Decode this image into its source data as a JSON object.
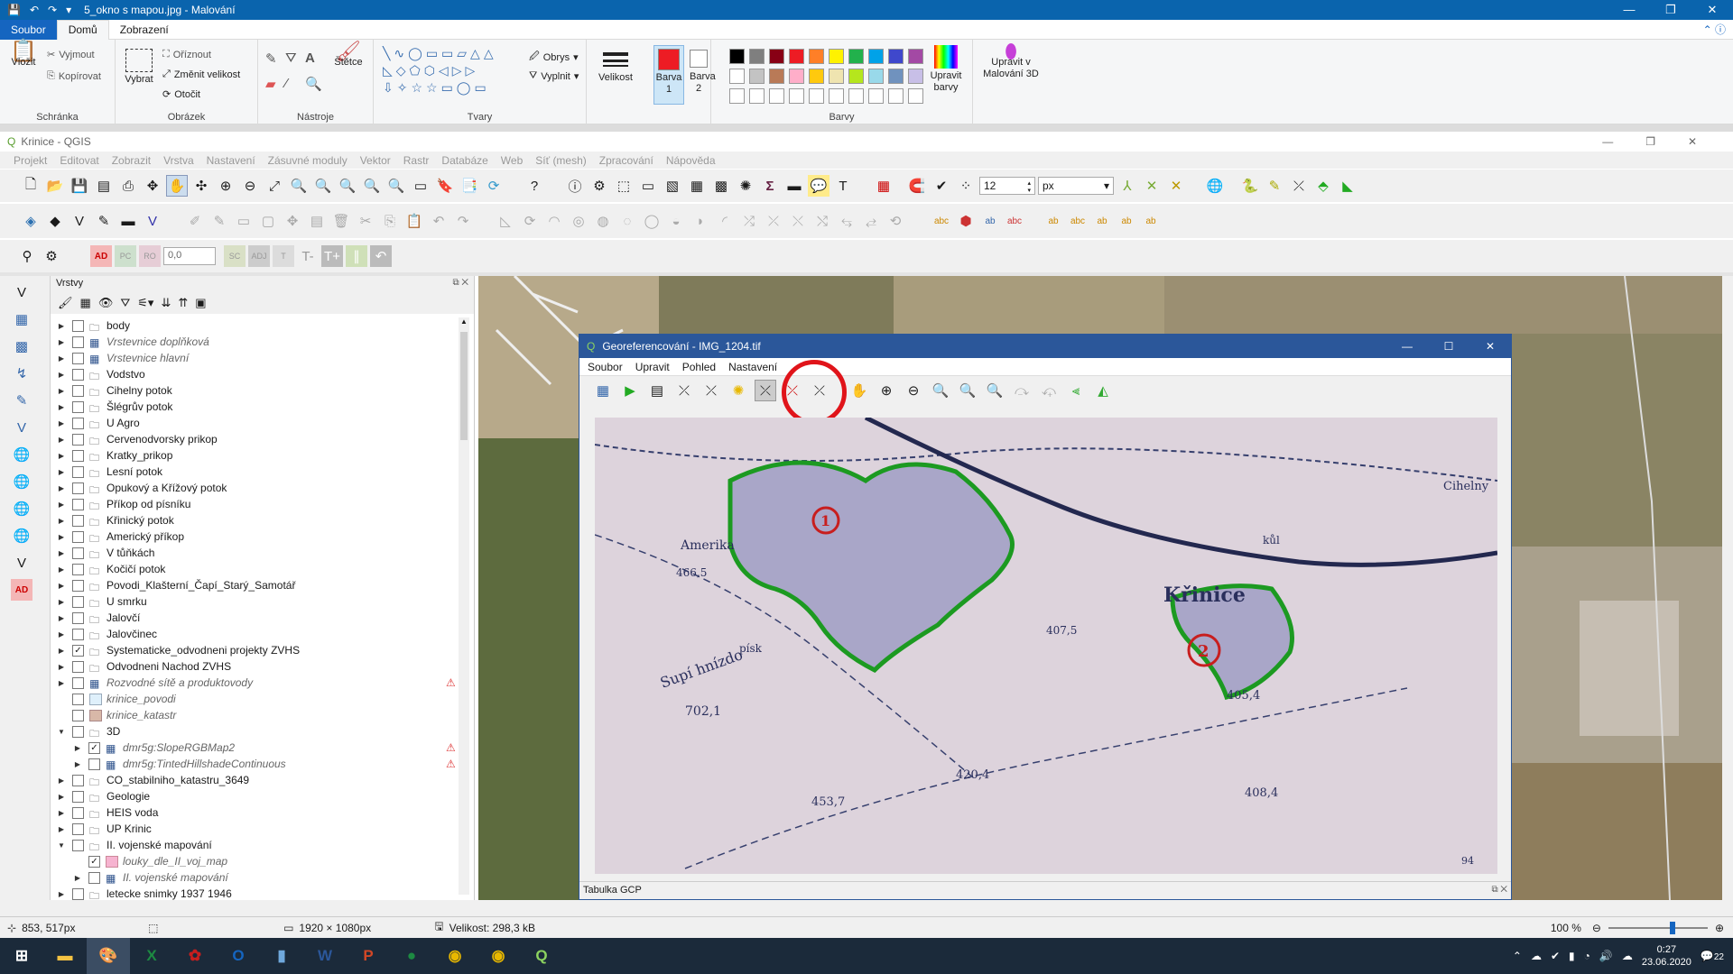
{
  "paint": {
    "title": "5_okno s mapou.jpg - Malování",
    "tabs": [
      "Soubor",
      "Domů",
      "Zobrazení"
    ],
    "clipboard": {
      "paste": "Vložit",
      "cut": "Vyjmout",
      "copy": "Kopírovat",
      "group": "Schránka"
    },
    "image": {
      "select": "Vybrat",
      "crop": "Oříznout",
      "resize": "Změnit velikost",
      "rotate": "Otočit",
      "group": "Obrázek"
    },
    "tools": {
      "group": "Nástroje",
      "brushes": "Štětce"
    },
    "shapes": {
      "outline": "Obrys",
      "fill": "Vyplnit",
      "group": "Tvary"
    },
    "size": "Velikost",
    "color1": "Barva\n1",
    "color2": "Barva\n2",
    "colors_group": "Barvy",
    "edit_colors": "Upravit\nbarvy",
    "paint3d": "Upravit v\nMalování 3D",
    "palette": [
      "#000000",
      "#7f7f7f",
      "#880015",
      "#ed1c24",
      "#ff7f27",
      "#fff200",
      "#22b14c",
      "#00a2e8",
      "#3f48cc",
      "#a349a4",
      "#ffffff",
      "#c3c3c3",
      "#b97a57",
      "#ffaec9",
      "#ffc90e",
      "#efe4b0",
      "#b5e61d",
      "#99d9ea",
      "#7092be",
      "#c8bfe7"
    ]
  },
  "qgis": {
    "title": "Krinice - QGIS",
    "menu": [
      "Projekt",
      "Editovat",
      "Zobrazit",
      "Vrstva",
      "Nastavení",
      "Zásuvné moduly",
      "Vektor",
      "Rastr",
      "Databáze",
      "Web",
      "Síť (mesh)",
      "Zpracování",
      "Nápověda"
    ],
    "font_size_value": "12",
    "unit_value": "px",
    "offset_value": "0,0",
    "label_ad": "AD",
    "layers_title": "Vrstvy",
    "layers": [
      {
        "name": "body",
        "checked": false,
        "italic": false,
        "exp": "▶",
        "warn": false
      },
      {
        "name": "Vrstevnice doplňková",
        "checked": false,
        "italic": true,
        "exp": "▶",
        "warn": false
      },
      {
        "name": "Vrstevnice hlavní",
        "checked": false,
        "italic": true,
        "exp": "▶",
        "warn": false
      },
      {
        "name": "Vodstvo",
        "checked": false,
        "italic": false,
        "exp": "▶",
        "warn": false
      },
      {
        "name": "Cihelny potok",
        "checked": false,
        "italic": false,
        "exp": "▶",
        "warn": false
      },
      {
        "name": "Šlégrův potok",
        "checked": false,
        "italic": false,
        "exp": "▶",
        "warn": false
      },
      {
        "name": "U Agro",
        "checked": false,
        "italic": false,
        "exp": "▶",
        "warn": false
      },
      {
        "name": "Cervenodvorsky prikop",
        "checked": false,
        "italic": false,
        "exp": "▶",
        "warn": false
      },
      {
        "name": "Kratky_prikop",
        "checked": false,
        "italic": false,
        "exp": "▶",
        "warn": false
      },
      {
        "name": "Lesní potok",
        "checked": false,
        "italic": false,
        "exp": "▶",
        "warn": false
      },
      {
        "name": "Opukový a Křížový potok",
        "checked": false,
        "italic": false,
        "exp": "▶",
        "warn": false
      },
      {
        "name": "Příkop od písníku",
        "checked": false,
        "italic": false,
        "exp": "▶",
        "warn": false
      },
      {
        "name": "Křinický potok",
        "checked": false,
        "italic": false,
        "exp": "▶",
        "warn": false
      },
      {
        "name": "Americký příkop",
        "checked": false,
        "italic": false,
        "exp": "▶",
        "warn": false
      },
      {
        "name": "V tůňkách",
        "checked": false,
        "italic": false,
        "exp": "▶",
        "warn": false
      },
      {
        "name": "Kočičí potok",
        "checked": false,
        "italic": false,
        "exp": "▶",
        "warn": false
      },
      {
        "name": "Povodi_Klašterní_Čapí_Starý_Samotář",
        "checked": false,
        "italic": false,
        "exp": "▶",
        "warn": false
      },
      {
        "name": "U smrku",
        "checked": false,
        "italic": false,
        "exp": "▶",
        "warn": false
      },
      {
        "name": "Jalovčí",
        "checked": false,
        "italic": false,
        "exp": "▶",
        "warn": false
      },
      {
        "name": "Jalovčinec",
        "checked": false,
        "italic": false,
        "exp": "▶",
        "warn": false
      },
      {
        "name": "Systematicke_odvodneni projekty ZVHS",
        "checked": true,
        "italic": false,
        "exp": "▶",
        "warn": false
      },
      {
        "name": "Odvodneni Nachod ZVHS",
        "checked": false,
        "italic": false,
        "exp": "▶",
        "warn": false
      },
      {
        "name": "Rozvodné sítě a produktovody",
        "checked": false,
        "italic": true,
        "exp": "▶",
        "warn": true
      },
      {
        "name": "krinice_povodi",
        "checked": false,
        "italic": true,
        "exp": "",
        "warn": false
      },
      {
        "name": "krinice_katastr",
        "checked": false,
        "italic": true,
        "exp": "",
        "warn": false
      },
      {
        "name": "3D",
        "checked": false,
        "italic": false,
        "exp": "▼",
        "warn": false
      },
      {
        "name": "dmr5g:SlopeRGBMap2",
        "checked": true,
        "italic": true,
        "exp": "▶",
        "warn": true
      },
      {
        "name": "dmr5g:TintedHillshadeContinuous",
        "checked": false,
        "italic": true,
        "exp": "▶",
        "warn": true
      },
      {
        "name": "CO_stabilniho_katastru_3649",
        "checked": false,
        "italic": false,
        "exp": "▶",
        "warn": false
      },
      {
        "name": "Geologie",
        "checked": false,
        "italic": false,
        "exp": "▶",
        "warn": false
      },
      {
        "name": "HEIS voda",
        "checked": false,
        "italic": false,
        "exp": "▶",
        "warn": false
      },
      {
        "name": "UP Krinic",
        "checked": false,
        "italic": false,
        "exp": "▶",
        "warn": false
      },
      {
        "name": "II. vojenské mapování",
        "checked": false,
        "italic": false,
        "exp": "▼",
        "warn": false
      },
      {
        "name": "louky_dle_II_voj_map",
        "checked": true,
        "italic": true,
        "exp": "",
        "warn": false
      },
      {
        "name": "II. vojenské mapování",
        "checked": false,
        "italic": true,
        "exp": "▶",
        "warn": false
      },
      {
        "name": "letecke snimky 1937 1946",
        "checked": false,
        "italic": false,
        "exp": "▶",
        "warn": false
      }
    ],
    "status": {
      "coords": "853, 517px",
      "dims": "1920 × 1080px",
      "size": "Velikost: 298,3 kB",
      "zoom": "100 %"
    }
  },
  "georef": {
    "title": "Georeferencování - IMG_1204.tif",
    "menu": [
      "Soubor",
      "Upravit",
      "Pohled",
      "Nastavení"
    ],
    "gcp_label": "Tabulka GCP",
    "map_labels": {
      "a1": "Amerika",
      "a2": "466,5",
      "a3": "Křinice",
      "a4": "Supí hnízdo",
      "a5": "702,1",
      "a6": "405,4",
      "a7": "408,4",
      "a8": "420,4",
      "a9": "453,7",
      "a10": "Cihelny",
      "a11": "407,5",
      "a12": "písk",
      "a13": "kůl",
      "a14": "94"
    }
  },
  "taskbar": {
    "time": "0:27",
    "date": "23.06.2020",
    "notif": "22"
  }
}
